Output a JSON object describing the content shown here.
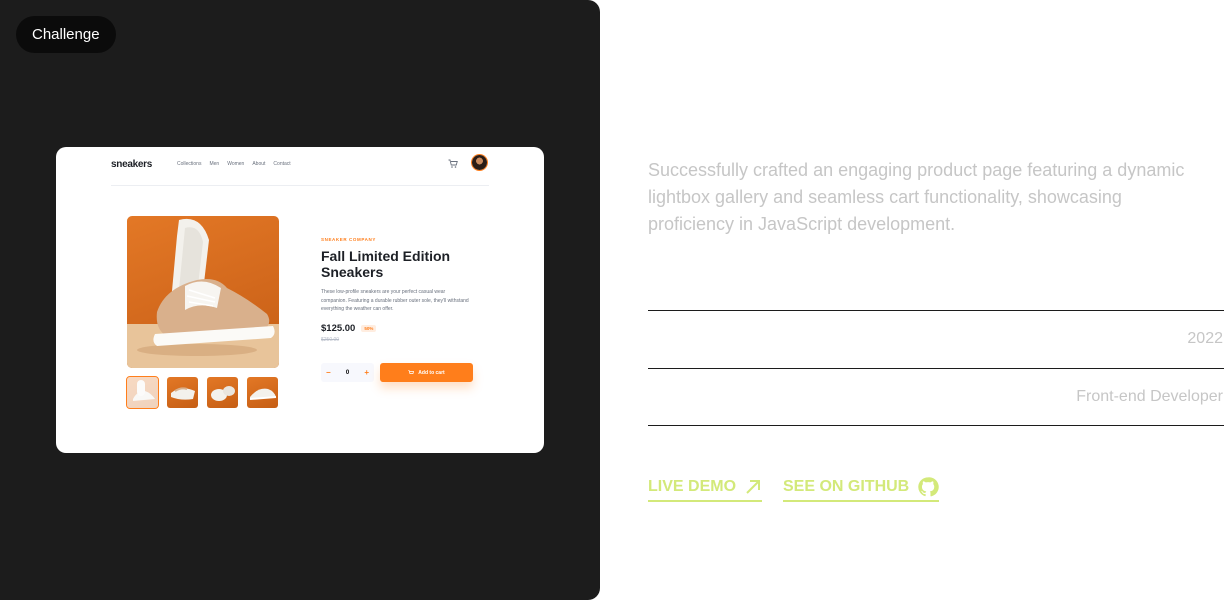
{
  "badge": {
    "label": "Challenge"
  },
  "preview": {
    "logo": "sneakers",
    "nav_links": [
      "Collections",
      "Men",
      "Women",
      "About",
      "Contact"
    ],
    "company": "SNEAKER COMPANY",
    "title": "Fall Limited Edition Sneakers",
    "description": "These low-profile sneakers are your perfect casual wear companion. Featuring a durable rubber outer sole, they'll withstand everything the weather can offer.",
    "price": "$125.00",
    "discount": "50%",
    "old_price": "$250.00",
    "quantity": "0",
    "add_to_cart": "Add to cart",
    "icons": {
      "cart": "cart-icon",
      "avatar": "avatar-image",
      "minus": "minus-icon",
      "plus": "plus-icon"
    },
    "colors": {
      "accent": "#ff7e1b",
      "text": "#1d2026"
    }
  },
  "project": {
    "summary": "Successfully crafted an engaging product page featuring a dynamic lightbox gallery and seamless cart functionality, showcasing proficiency in JavaScript development.",
    "year": "2022",
    "role": "Front-end Developer"
  },
  "links": {
    "live_demo": "LIVE DEMO",
    "github": "SEE ON GITHUB",
    "icons": {
      "live_demo": "arrow-up-right-icon",
      "github": "github-icon"
    }
  },
  "colors": {
    "panel_bg": "#1c1c1c",
    "link": "#d3e97a",
    "muted_text": "#c6c6c6"
  }
}
